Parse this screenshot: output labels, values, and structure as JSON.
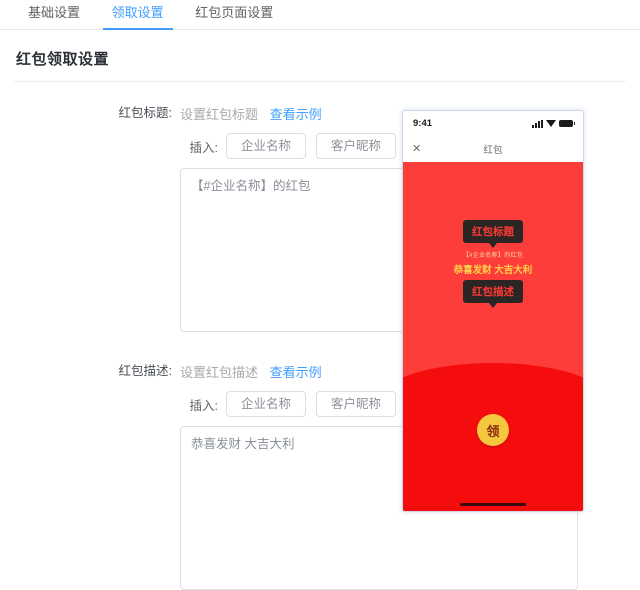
{
  "tabs": [
    {
      "label": "基础设置",
      "active": false
    },
    {
      "label": "领取设置",
      "active": true
    },
    {
      "label": "红包页面设置",
      "active": false
    }
  ],
  "page": {
    "heading": "红包领取设置"
  },
  "form": {
    "title_section": {
      "label": "红包标题:",
      "hint": "设置红包标题",
      "example_link": "查看示例",
      "insert_label": "插入:",
      "insert_buttons": [
        "企业名称",
        "客户昵称"
      ],
      "textarea_value": "【#企业名称】的红包"
    },
    "desc_section": {
      "label": "红包描述:",
      "hint": "设置红包描述",
      "example_link": "查看示例",
      "insert_label": "插入:",
      "insert_buttons": [
        "企业名称",
        "客户昵称"
      ],
      "textarea_value": "恭喜发财 大吉大利"
    }
  },
  "phone": {
    "status_time": "9:41",
    "status_icons": [
      "signal-icon",
      "wifi-icon",
      "battery-icon"
    ],
    "nav_close": "✕",
    "nav_title": "红包",
    "tip_title": "红包标题",
    "tip_desc": "红包描述",
    "preview_title": "【#企业名称】的红包",
    "preview_desc": "恭喜发财 大吉大利",
    "open_button": "领",
    "colors": {
      "body_top": "#fc3d39",
      "body_bottom": "#f50d0d",
      "open_button": "#f5c73e",
      "tip_box": "#2b2523",
      "tip_text": "#ff3a35",
      "desc_text": "#ffd24a"
    }
  },
  "theme": {
    "accent": "#409eff",
    "border": "#dcdfe6",
    "text": "#606266"
  }
}
